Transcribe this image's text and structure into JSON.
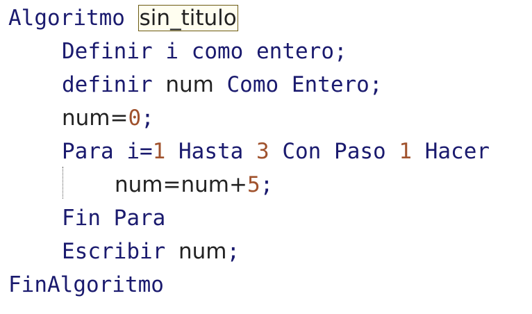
{
  "code": {
    "line1": {
      "keyword": "Algoritmo",
      "name": "sin_titulo"
    },
    "line2": {
      "kw_definir": "Definir",
      "var_i": "i",
      "kw_como": "como",
      "kw_tipo": "entero",
      "semicolon": ";"
    },
    "line3": {
      "kw_definir": "definir",
      "var_num": "num",
      "kw_como": "Como",
      "kw_tipo": "Entero",
      "semicolon": ";"
    },
    "line4": {
      "var_num": "num",
      "op_assign": "=",
      "value": "0",
      "semicolon": ";"
    },
    "line5": {
      "kw_para": "Para",
      "var_i": "i",
      "op_assign": "=",
      "start": "1",
      "kw_hasta": "Hasta",
      "end": "3",
      "kw_con": "Con",
      "kw_paso": "Paso",
      "step": "1",
      "kw_hacer": "Hacer"
    },
    "line6": {
      "var_num": "num",
      "op_assign": "=",
      "var_num2": "num",
      "op_plus": "+",
      "value": "5",
      "semicolon": ";"
    },
    "line7": {
      "keyword": "Fin Para"
    },
    "line8": {
      "kw_escribir": "Escribir",
      "var_num": "num",
      "semicolon": ";"
    },
    "line9": {
      "keyword": "FinAlgoritmo"
    }
  },
  "colors": {
    "keyword": "#1a1a6e",
    "identifier": "#222222",
    "number": "#a0522d",
    "highlight_border": "#6b5a12"
  }
}
